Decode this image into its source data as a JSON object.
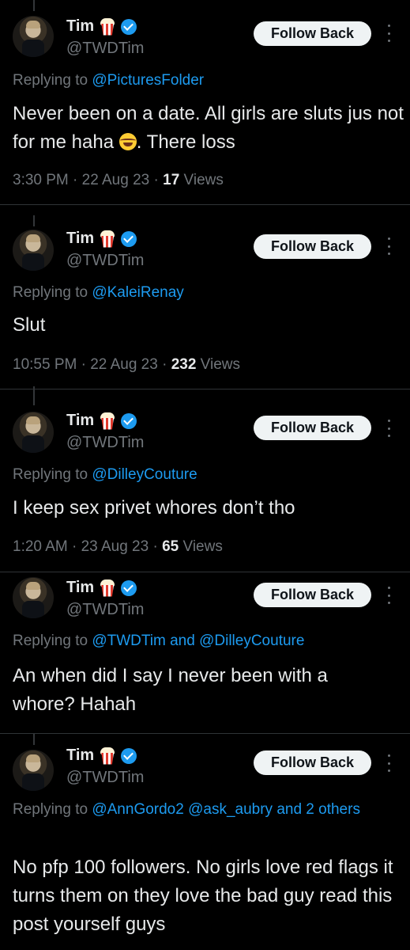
{
  "tweets": [
    {
      "name": "Tim",
      "handle": "@TWDTim",
      "follow_label": "Follow Back",
      "reply_prefix": "Replying to ",
      "reply_to": "@PicturesFolder",
      "text_before_emoji": "Never been on a date. All girls are sluts jus not for me haha ",
      "text_after_emoji": ". There loss",
      "time": "3:30 PM · 22 Aug 23 · ",
      "views_count": "17",
      "views_label": " Views"
    },
    {
      "name": "Tim",
      "handle": "@TWDTim",
      "follow_label": "Follow Back",
      "reply_prefix": "Replying to ",
      "reply_to": "@KaleiRenay",
      "text": "Slut",
      "time": "10:55 PM · 22 Aug 23 · ",
      "views_count": "232",
      "views_label": " Views"
    },
    {
      "name": "Tim",
      "handle": "@TWDTim",
      "follow_label": "Follow Back",
      "reply_prefix": "Replying to ",
      "reply_to": "@DilleyCouture",
      "text": "I keep sex privet whores don’t tho",
      "time": "1:20 AM · 23 Aug 23 · ",
      "views_count": "65",
      "views_label": " Views"
    },
    {
      "name": "Tim",
      "handle": "@TWDTim",
      "follow_label": "Follow Back",
      "reply_prefix": "Replying to ",
      "reply_to": "@TWDTim and @DilleyCouture",
      "text": "An when did I say I never been with a whore? Hahah"
    },
    {
      "name": "Tim",
      "handle": "@TWDTim",
      "follow_label": "Follow Back",
      "reply_prefix": "Replying to ",
      "reply_to": "@AnnGordo2 @ask_aubry and 2 others",
      "text": "No pfp 100 followers. No girls love red flags it turns them on they love the bad guy read this post yourself guys"
    }
  ],
  "icons": {
    "name_emoji": "popcorn-icon",
    "verified": "verified-badge-icon",
    "more": "more-options-icon",
    "inline_emoji": "tears-of-joy-emoji"
  },
  "colors": {
    "background": "#000000",
    "text": "#e7e9ea",
    "secondary": "#71767b",
    "link": "#1d9bf0",
    "button_bg": "#eff3f4"
  }
}
